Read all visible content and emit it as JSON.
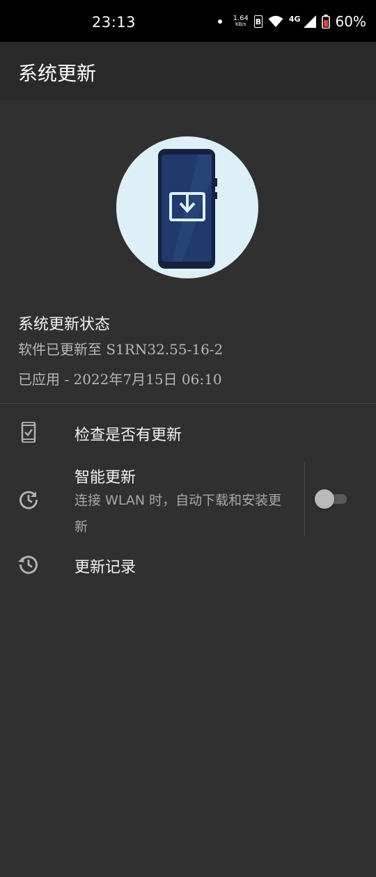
{
  "status_bar": {
    "time": "23:13",
    "net_speed_value": "1.64",
    "net_speed_unit": "KB/s",
    "network_type": "4G",
    "battery": "60%"
  },
  "app_bar": {
    "title": "系统更新"
  },
  "hero": {
    "icon": "phone-download-icon"
  },
  "status_section": {
    "title": "系统更新状态",
    "version_line": "软件已更新至 S1RN32.55-16-2",
    "applied_line": "已应用 - 2022年7月15日 06:10"
  },
  "menu": {
    "check_updates": {
      "label": "检查是否有更新",
      "icon": "phone-check-icon"
    },
    "smart_update": {
      "label": "智能更新",
      "description": "连接 WLAN 时，自动下载和安装更新",
      "icon": "refresh-clock-icon",
      "enabled": false
    },
    "update_history": {
      "label": "更新记录",
      "icon": "history-icon"
    }
  },
  "colors": {
    "background": "#303030",
    "app_bar": "#2a2a2a",
    "hero_circle": "#ddf0f8",
    "phone_body": "#1f3a6b"
  }
}
